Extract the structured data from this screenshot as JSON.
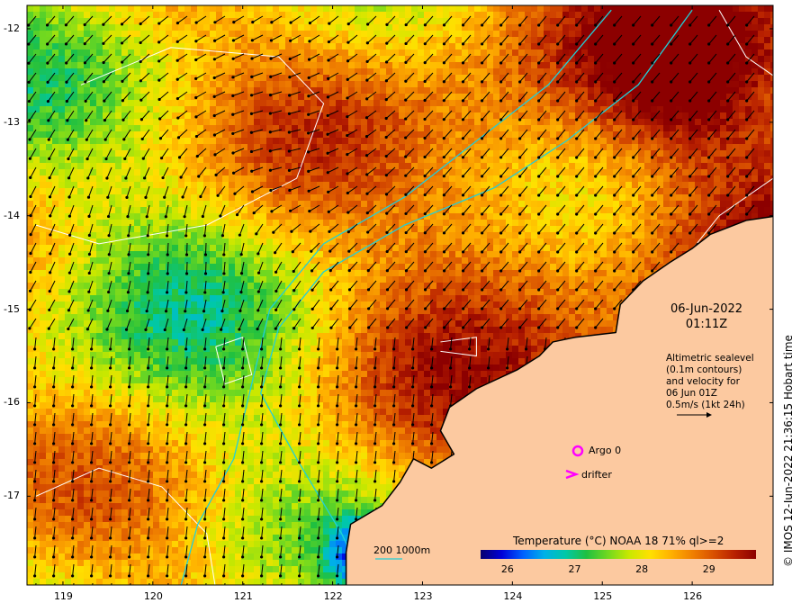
{
  "chart_data": {
    "type": "heatmap",
    "title": "Temperature (°C) NOAA 18 71% ql>=2",
    "x_ticks": [
      "119",
      "120",
      "121",
      "122",
      "123",
      "124",
      "125",
      "126"
    ],
    "y_ticks": [
      "-12",
      "-13",
      "-14",
      "-15",
      "-16",
      "-17"
    ],
    "xlim": [
      118.6,
      126.9
    ],
    "ylim": [
      -17.95,
      -11.75
    ],
    "colorbar": {
      "ticks": [
        "26",
        "27",
        "28",
        "29"
      ],
      "range": [
        25.6,
        29.7
      ],
      "stops": [
        "#08006e",
        "#0000d8",
        "#0060ff",
        "#00b0e8",
        "#00c8a8",
        "#20c040",
        "#70d820",
        "#c8e800",
        "#ffe000",
        "#ffb000",
        "#f08000",
        "#d85000",
        "#b82000",
        "#8c0000"
      ]
    },
    "grid": false
  },
  "annotations": {
    "date": "06-Jun-2022",
    "time": "01:11Z",
    "info_lines": [
      "Altimetric sealevel",
      "(0.1m contours)",
      "and velocity for",
      "06 Jun 01Z",
      "0.5m/s (1kt 24h)"
    ],
    "credit": "© IMOS 12-Jun-2022 21:36:15 Hobart time",
    "bathymetry_label": "200  1000m"
  },
  "legend": {
    "argo_label": "Argo 0",
    "drifter_label": "drifter",
    "marker_color": "#ff00ff"
  },
  "colors": {
    "land": "#fcc9a0",
    "coast": "#000000",
    "bathy": "#20d0d8",
    "contour": "#ffffff"
  }
}
